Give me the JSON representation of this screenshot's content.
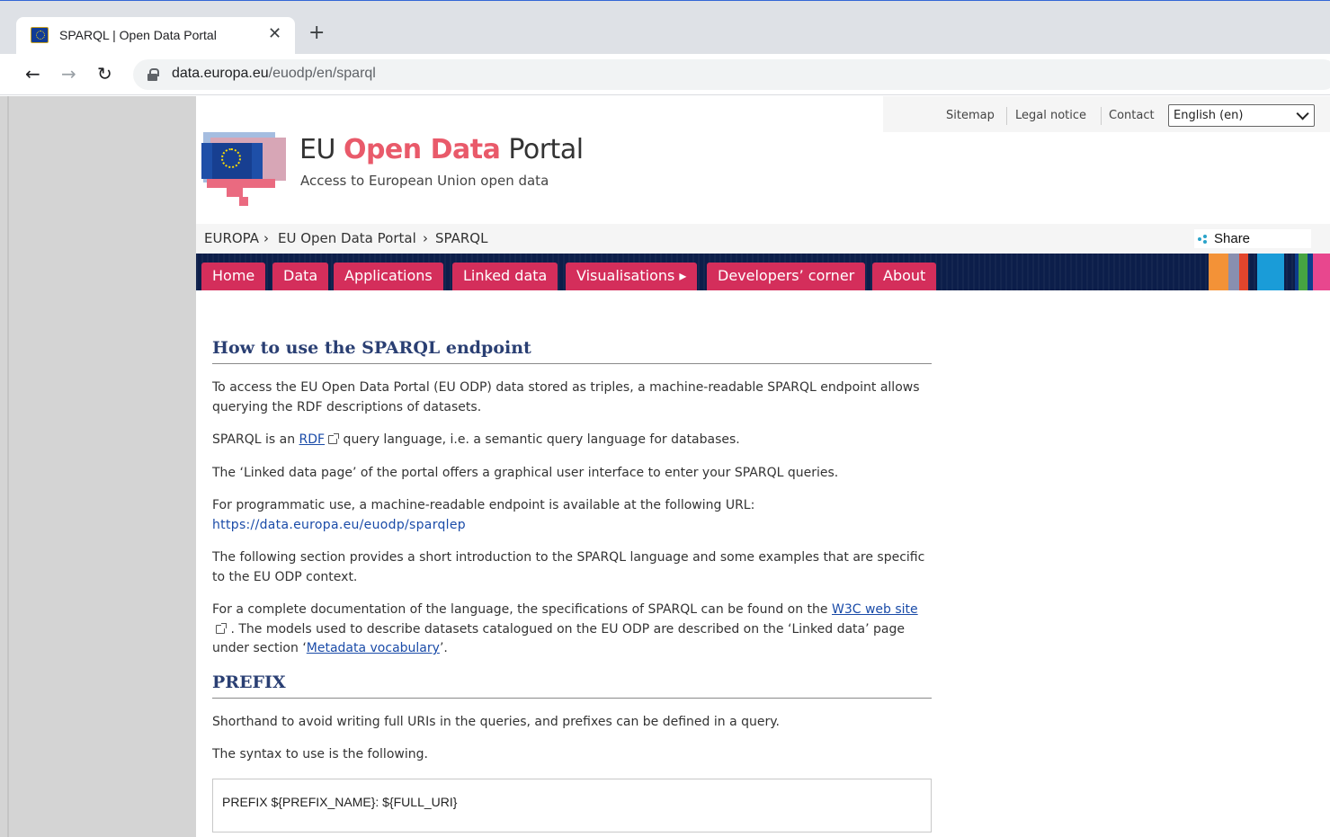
{
  "browser": {
    "tab_title": "SPARQL | Open Data Portal",
    "url_host": "data.europa.eu",
    "url_path": "/euodp/en/sparql"
  },
  "utility": {
    "links": [
      "Sitemap",
      "Legal notice",
      "Contact"
    ],
    "language": "English (en)"
  },
  "header": {
    "title_prefix": "EU ",
    "title_accent": "Open Data",
    "title_suffix": " Portal",
    "subtitle": "Access to European Union open data"
  },
  "breadcrumb": [
    "EUROPA",
    "EU Open Data Portal",
    "SPARQL"
  ],
  "share_label": "Share",
  "nav": [
    "Home",
    "Data",
    "Applications",
    "Linked data",
    "Visualisations ▸",
    "Developers’ corner",
    "About"
  ],
  "brand_colors": [
    "#f39237",
    "#888fb0",
    "#e2452c",
    "#1a9cd8",
    "#0d3d8c",
    "#46a441",
    "#e8478e"
  ],
  "content": {
    "h1": "How to use the SPARQL endpoint",
    "p1": "To access the EU Open Data Portal (EU ODP) data stored as triples, a machine-readable SPARQL endpoint allows querying the RDF descriptions of datasets.",
    "p2_a": "SPARQL is an ",
    "p2_link": "RDF",
    "p2_b": " query language, i.e. a semantic query language for databases.",
    "p3": "The ‘Linked data page’ of the portal offers a graphical user interface to enter your SPARQL queries.",
    "p4": "For programmatic use, a machine-readable endpoint is available at the following URL:",
    "p4_url": "https://data.europa.eu/euodp/sparqlep",
    "p5": "The following section provides a short introduction to the SPARQL language and some examples that are specific to the EU ODP context.",
    "p6_a": "For a complete documentation of the language, the specifications of SPARQL can be found on the ",
    "p6_link1": "W3C web site",
    "p6_b": " . The models used to describe datasets catalogued on the EU ODP are described on the ‘Linked data’ page under section ‘",
    "p6_link2": "Metadata vocabulary",
    "p6_c": "’.",
    "h2": "PREFIX",
    "p7": "Shorthand to avoid writing full URIs in the queries, and prefixes can be defined in a query.",
    "p8": "The syntax to use is the following.",
    "code": "PREFIX ${PREFIX_NAME}: ${FULL_URI}"
  }
}
